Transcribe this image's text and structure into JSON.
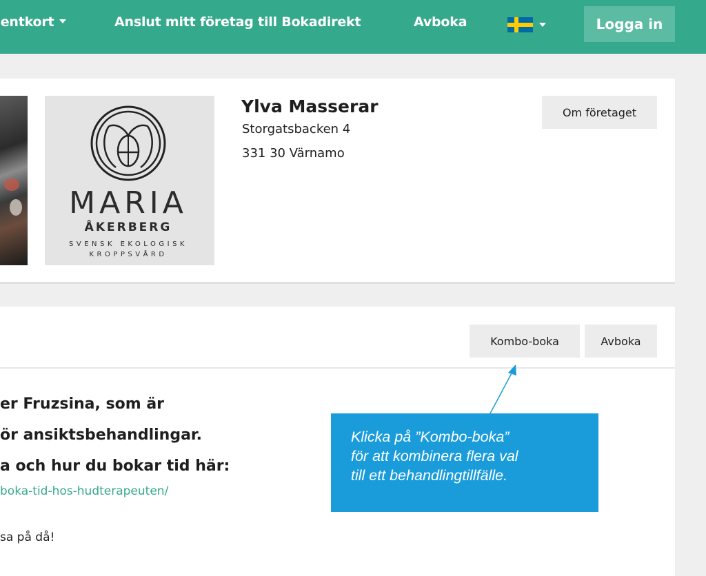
{
  "nav": {
    "gift_cards": "Presentkort",
    "connect_company": "Anslut mitt företag till Bokadirekt",
    "cancel_booking": "Avboka",
    "language": "Svenska",
    "login": "Logga in"
  },
  "company": {
    "name": "Ylva Masserar",
    "street": "Storgatsbacken 4",
    "postal_city": "331 30 Värnamo",
    "about_button": "Om företaget",
    "logo": {
      "brand": "MARIA",
      "brand_sub": "ÅKERBERG",
      "tagline_1": "SVENSK EKOLOGISK",
      "tagline_2": "KROPPSVÅRD"
    }
  },
  "services": {
    "combo_button": "Kombo-boka",
    "cancel_button": "Avboka",
    "description_lines": [
      "er Fruzsina, som är",
      "ör ansiktsbehandlingar.",
      "a och hur du bokar tid här:"
    ],
    "link_text": "boka-tid-hos-hudterapeuten/",
    "closing_text": "sa på då!"
  },
  "callout": {
    "lines": [
      "Klicka på ”Kombo-boka”",
      "för att kombinera flera val",
      "till ett behandlingtillfälle."
    ],
    "color": "#1a9cdb"
  },
  "colors": {
    "brand_green": "#35a98c",
    "login_button": "#5cbba3"
  }
}
